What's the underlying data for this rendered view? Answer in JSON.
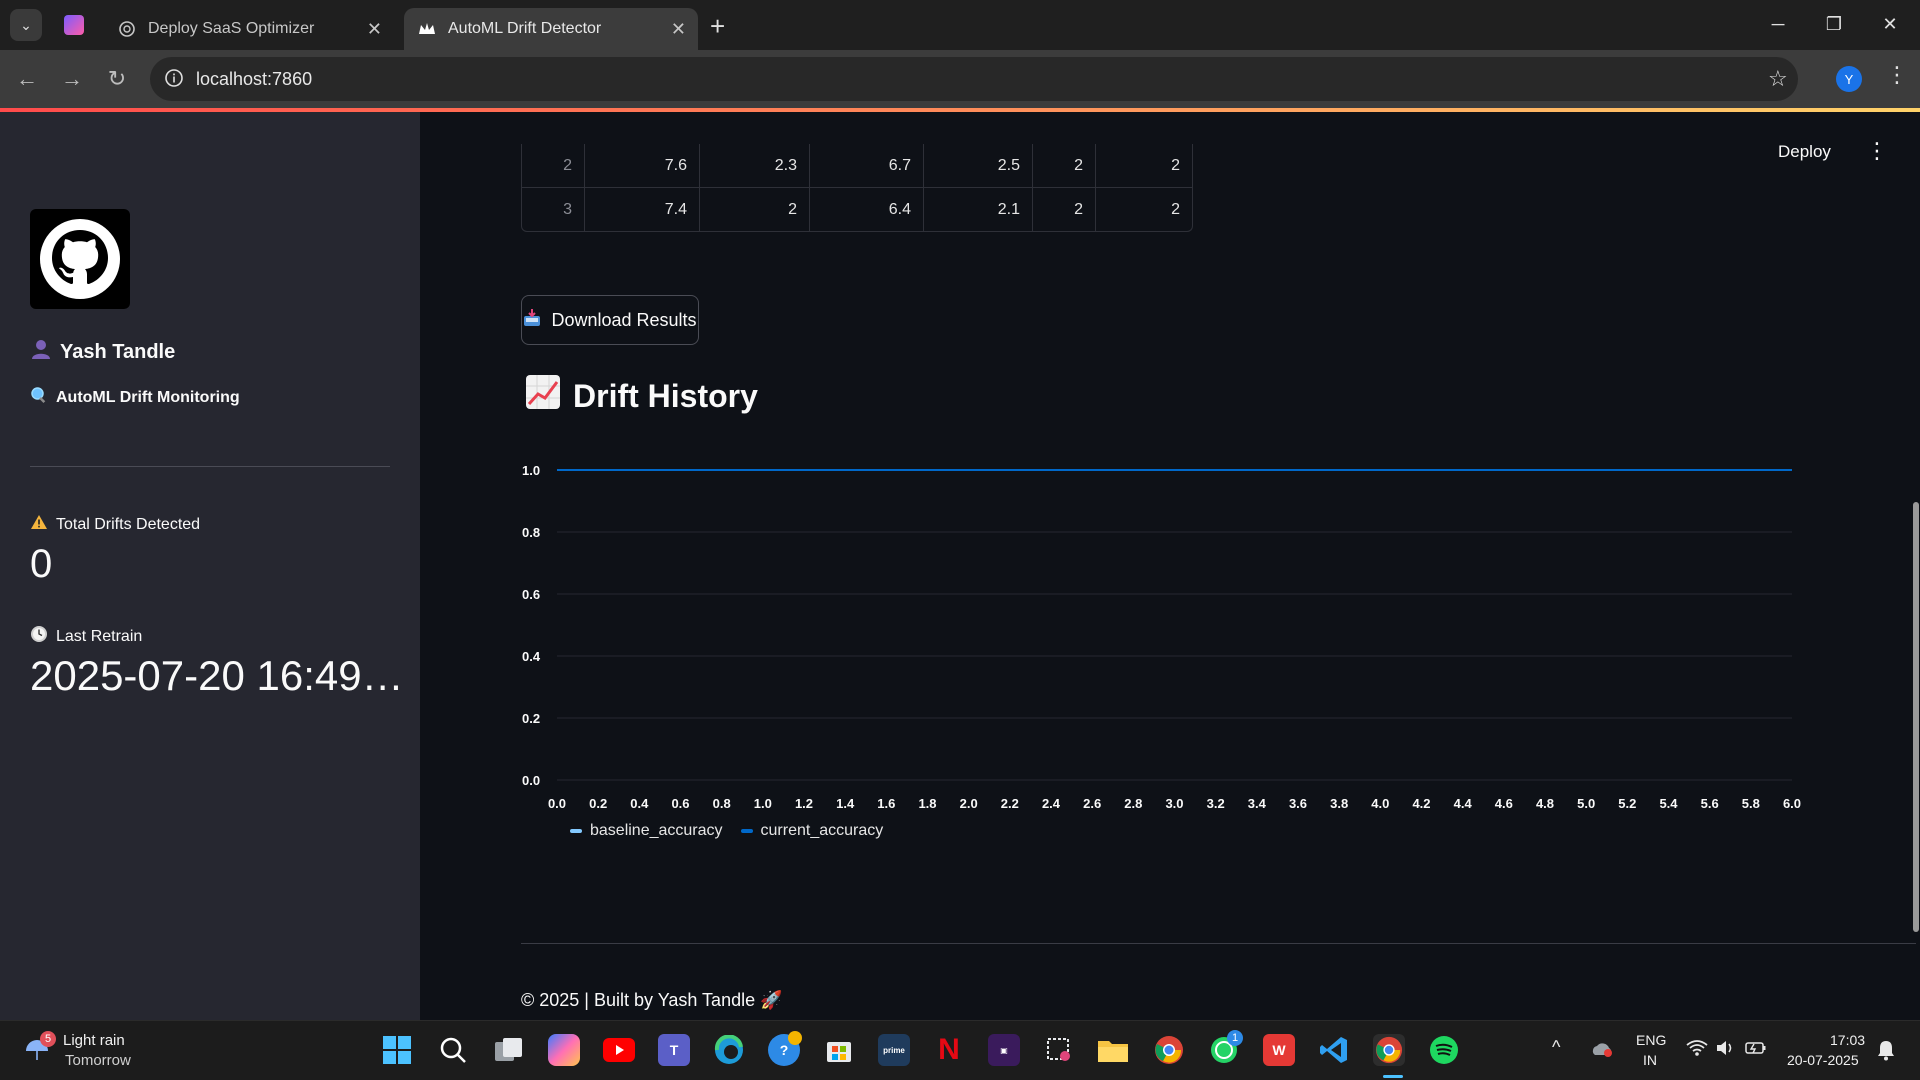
{
  "browser": {
    "tabs": [
      {
        "label": "Deploy SaaS Optimizer",
        "active": false
      },
      {
        "label": "AutoML Drift Detector",
        "active": true
      }
    ],
    "url": "localhost:7860",
    "profile_initial": "Y"
  },
  "sidebar": {
    "user_name": "Yash Tandle",
    "subtitle": "AutoML Drift Monitoring",
    "metrics": {
      "drifts_label": "Total Drifts Detected",
      "drifts_value": "0",
      "retrain_label": "Last Retrain",
      "retrain_value": "2025-07-20 16:49…"
    }
  },
  "header": {
    "deploy_label": "Deploy"
  },
  "table": {
    "rows": [
      {
        "index": "2",
        "values": [
          "7.6",
          "2.3",
          "6.7",
          "2.5",
          "2",
          "2"
        ]
      },
      {
        "index": "3",
        "values": [
          "7.4",
          "2",
          "6.4",
          "2.1",
          "2",
          "2"
        ]
      }
    ]
  },
  "actions": {
    "download_label": "Download Results"
  },
  "section": {
    "title": "Drift History"
  },
  "chart_data": {
    "type": "line",
    "x_ticks": [
      "0.0",
      "0.2",
      "0.4",
      "0.6",
      "0.8",
      "1.0",
      "1.2",
      "1.4",
      "1.6",
      "1.8",
      "2.0",
      "2.2",
      "2.4",
      "2.6",
      "2.8",
      "3.0",
      "3.2",
      "3.4",
      "3.6",
      "3.8",
      "4.0",
      "4.2",
      "4.4",
      "4.6",
      "4.8",
      "5.0",
      "5.2",
      "5.4",
      "5.6",
      "5.8",
      "6.0"
    ],
    "y_ticks": [
      "0.0",
      "0.2",
      "0.4",
      "0.6",
      "0.8",
      "1.0"
    ],
    "xlim": [
      0,
      6
    ],
    "ylim": [
      0,
      1
    ],
    "series": [
      {
        "name": "baseline_accuracy",
        "color": "#83c9ff",
        "x": [
          0,
          6
        ],
        "y": [
          1.0,
          1.0
        ]
      },
      {
        "name": "current_accuracy",
        "color": "#0068c9",
        "x": [
          0,
          6
        ],
        "y": [
          1.0,
          1.0
        ]
      }
    ],
    "grid": true,
    "legend": "bottom-left"
  },
  "footer": {
    "text": "© 2025 | Built by Yash Tandle 🚀"
  },
  "taskbar": {
    "weather_title": "Light rain",
    "weather_sub": "Tomorrow",
    "weather_badge": "5",
    "lang_top": "ENG",
    "lang_bottom": "IN",
    "time": "17:03",
    "date": "20-07-2025",
    "whatsapp_badge": "1"
  },
  "colors": {
    "accent": "#ff4b4b",
    "sidebar_bg": "#262730",
    "main_bg": "#0e1117"
  }
}
